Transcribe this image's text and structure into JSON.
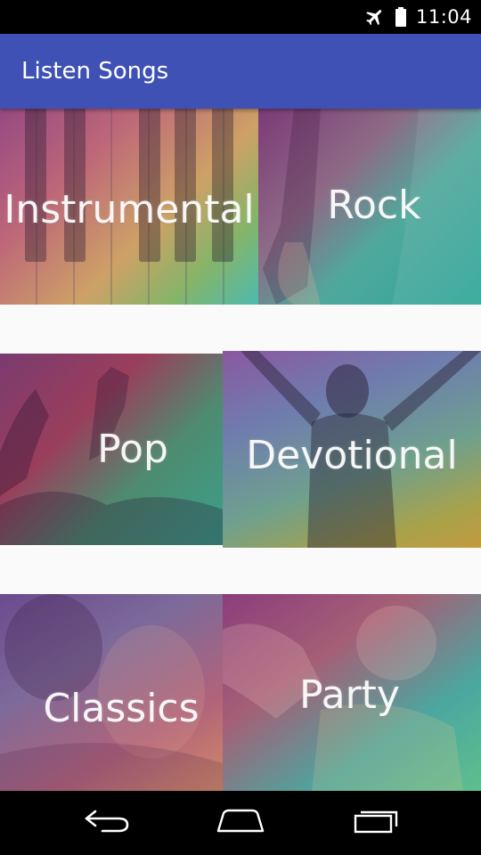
{
  "status_bar": {
    "time": "11:04",
    "icons": [
      "airplane-mode-icon",
      "battery-icon"
    ]
  },
  "app_bar": {
    "title": "Listen Songs",
    "color": "#3f51b5"
  },
  "categories": [
    {
      "label": "Instrumental",
      "image": "piano-keys"
    },
    {
      "label": "Rock",
      "image": "guitar"
    },
    {
      "label": "Pop",
      "image": "concert-crowd"
    },
    {
      "label": "Devotional",
      "image": "person-raised-arms"
    },
    {
      "label": "Classics",
      "image": "faces"
    },
    {
      "label": "Party",
      "image": "dancing-woman"
    }
  ],
  "nav_bar": {
    "icons": [
      "back-icon",
      "home-icon",
      "recents-icon"
    ]
  }
}
